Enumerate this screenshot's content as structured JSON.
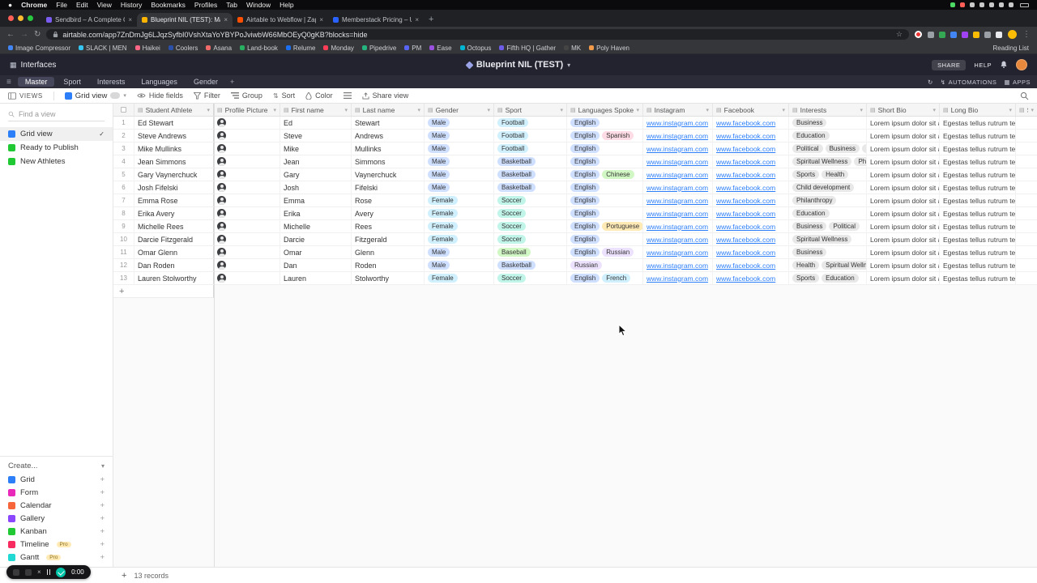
{
  "macos": {
    "menus": [
      "Chrome",
      "File",
      "Edit",
      "View",
      "History",
      "Bookmarks",
      "Profiles",
      "Tab",
      "Window",
      "Help"
    ],
    "status_colors": [
      "#4cd964",
      "#ff5f57",
      "#c9c9c9",
      "#c9c9c9",
      "#c9c9c9",
      "#c9c9c9",
      "#c9c9c9"
    ]
  },
  "browser": {
    "tabs": [
      {
        "title": "Sendbird – A Complete Chat P",
        "favicon": "#7a5cf0",
        "active": false
      },
      {
        "title": "Blueprint NIL (TEST): Master",
        "favicon": "#fcb400",
        "active": true
      },
      {
        "title": "Airtable to Webflow | Zapier",
        "favicon": "#ff4f00",
        "active": false
      },
      {
        "title": "Memberstack Pricing – Unlim",
        "favicon": "#2962ff",
        "active": false
      }
    ],
    "url": "airtable.com/app7ZnDmJg6LJqzSyfbI0VshXtaYoYBYPoJviwbW66MbOEyQ0gKB?blocks=hide",
    "extensions": [
      "#9aa0a6",
      "#34a853",
      "#4285f4",
      "#a142f4",
      "#fbbc04",
      "#9aa0a6",
      "#e8eaed"
    ],
    "reading_list": "Reading List",
    "bookmarks": [
      {
        "label": "Image Compressor",
        "color": "#4285f4"
      },
      {
        "label": "SLACK | MEN",
        "color": "#36c5f0"
      },
      {
        "label": "Haikei",
        "color": "#ff6584"
      },
      {
        "label": "Coolers",
        "color": "#2b50aa"
      },
      {
        "label": "Asana",
        "color": "#f06a6a"
      },
      {
        "label": "Land-book",
        "color": "#27ae60"
      },
      {
        "label": "Relume",
        "color": "#1d6ff2"
      },
      {
        "label": "Monday",
        "color": "#ff3d57"
      },
      {
        "label": "Pipedrive",
        "color": "#24b47e"
      },
      {
        "label": "PM",
        "color": "#5865f2"
      },
      {
        "label": "Ease",
        "color": "#9b51e0"
      },
      {
        "label": "Octopus",
        "color": "#00b5d1"
      },
      {
        "label": "Fifth HQ | Gather",
        "color": "#6c5ce7"
      },
      {
        "label": "MK",
        "color": "#444444"
      },
      {
        "label": "Poly Haven",
        "color": "#f2994a"
      }
    ]
  },
  "airtable": {
    "header": {
      "interfaces_label": "Interfaces",
      "title": "Blueprint NIL (TEST)",
      "share_label": "SHARE",
      "help_label": "HELP"
    },
    "tabbar": {
      "tabs": [
        "Master",
        "Sport",
        "Interests",
        "Languages",
        "Gender"
      ],
      "active": "Master",
      "automations_label": "AUTOMATIONS",
      "apps_label": "APPS"
    },
    "toolbar": {
      "views_label": "VIEWS",
      "view_name": "Grid view",
      "hide_fields": "Hide fields",
      "filter": "Filter",
      "group": "Group",
      "sort": "Sort",
      "color": "Color",
      "share_view": "Share view"
    },
    "sidebar": {
      "find_placeholder": "Find a view",
      "views": [
        {
          "name": "Grid view",
          "color": "#2d7ff9",
          "active": true
        },
        {
          "name": "Ready to Publish",
          "color": "#20c933",
          "active": false
        },
        {
          "name": "New Athletes",
          "color": "#20c933",
          "active": false
        }
      ],
      "create_label": "Create...",
      "create_items": [
        {
          "name": "Grid",
          "color": "#2d7ff9",
          "badge": ""
        },
        {
          "name": "Form",
          "color": "#e929ba",
          "badge": ""
        },
        {
          "name": "Calendar",
          "color": "#f7653b",
          "badge": ""
        },
        {
          "name": "Gallery",
          "color": "#8b46ff",
          "badge": ""
        },
        {
          "name": "Kanban",
          "color": "#20c933",
          "badge": ""
        },
        {
          "name": "Timeline",
          "color": "#f82b60",
          "badge": "Pro"
        },
        {
          "name": "Gantt",
          "color": "#20d9d2",
          "badge": "Pro"
        }
      ]
    },
    "grid": {
      "columns": [
        {
          "key": "name",
          "label": "Student Athlete"
        },
        {
          "key": "photo",
          "label": "Profile Picture"
        },
        {
          "key": "first",
          "label": "First name"
        },
        {
          "key": "last",
          "label": "Last name"
        },
        {
          "key": "gender",
          "label": "Gender"
        },
        {
          "key": "sport",
          "label": "Sport"
        },
        {
          "key": "languages",
          "label": "Languages Spoken"
        },
        {
          "key": "instagram",
          "label": "Instagram"
        },
        {
          "key": "facebook",
          "label": "Facebook"
        },
        {
          "key": "interests",
          "label": "Interests"
        },
        {
          "key": "short_bio",
          "label": "Short Bio"
        },
        {
          "key": "long_bio",
          "label": "Long Bio"
        },
        {
          "key": "stat",
          "label": "Stat"
        }
      ],
      "rows": [
        {
          "name": "Ed Stewart",
          "first": "Ed",
          "last": "Stewart",
          "gender": "Male",
          "sport": "Football",
          "languages": [
            "English"
          ],
          "instagram": "www.instagram.com",
          "facebook": "www.facebook.com",
          "interests": [
            "Business"
          ],
          "short_bio": "Lorem ipsum dolor sit amet, consectetur",
          "long_bio": "Egestas tellus rutrum tellus pellentesque"
        },
        {
          "name": "Steve Andrews",
          "first": "Steve",
          "last": "Andrews",
          "gender": "Male",
          "sport": "Football",
          "languages": [
            "English",
            "Spanish"
          ],
          "instagram": "www.instagram.com",
          "facebook": "www.facebook.com",
          "interests": [
            "Education"
          ],
          "short_bio": "Lorem ipsum dolor sit amet, consectetur",
          "long_bio": "Egestas tellus rutrum tellus pellentesque"
        },
        {
          "name": "Mike Mullinks",
          "first": "Mike",
          "last": "Mullinks",
          "gender": "Male",
          "sport": "Football",
          "languages": [
            "English"
          ],
          "instagram": "www.instagram.com",
          "facebook": "www.facebook.com",
          "interests": [
            "Political",
            "Business",
            "Community"
          ],
          "short_bio": "Lorem ipsum dolor sit amet, consectetur",
          "long_bio": "Egestas tellus rutrum tellus pellentesque"
        },
        {
          "name": "Jean Simmons",
          "first": "Jean",
          "last": "Simmons",
          "gender": "Male",
          "sport": "Basketball",
          "languages": [
            "English"
          ],
          "instagram": "www.instagram.com",
          "facebook": "www.facebook.com",
          "interests": [
            "Spiritual Wellness",
            "Philanthropy"
          ],
          "short_bio": "Lorem ipsum dolor sit amet, consectetur",
          "long_bio": "Egestas tellus rutrum tellus pellentesque"
        },
        {
          "name": "Gary Vaynerchuck",
          "first": "Gary",
          "last": "Vaynerchuck",
          "gender": "Male",
          "sport": "Basketball",
          "languages": [
            "English",
            "Chinese"
          ],
          "instagram": "www.instagram.com",
          "facebook": "www.facebook.com",
          "interests": [
            "Sports",
            "Health"
          ],
          "short_bio": "Lorem ipsum dolor sit amet, consectetur",
          "long_bio": "Egestas tellus rutrum tellus pellentesque"
        },
        {
          "name": "Josh Fifelski",
          "first": "Josh",
          "last": "Fifelski",
          "gender": "Male",
          "sport": "Basketball",
          "languages": [
            "English"
          ],
          "instagram": "www.instagram.com",
          "facebook": "www.facebook.com",
          "interests": [
            "Child development"
          ],
          "short_bio": "Lorem ipsum dolor sit amet, consectetur",
          "long_bio": "Egestas tellus rutrum tellus pellentesque"
        },
        {
          "name": "Emma Rose",
          "first": "Emma",
          "last": "Rose",
          "gender": "Female",
          "sport": "Soccer",
          "languages": [
            "English"
          ],
          "instagram": "www.instagram.com",
          "facebook": "www.facebook.com",
          "interests": [
            "Philanthropy"
          ],
          "short_bio": "Lorem ipsum dolor sit amet, consectetur",
          "long_bio": "Egestas tellus rutrum tellus pellentesque"
        },
        {
          "name": "Erika Avery",
          "first": "Erika",
          "last": "Avery",
          "gender": "Female",
          "sport": "Soccer",
          "languages": [
            "English"
          ],
          "instagram": "www.instagram.com",
          "facebook": "www.facebook.com",
          "interests": [
            "Education"
          ],
          "short_bio": "Lorem ipsum dolor sit amet, consectetur",
          "long_bio": "Egestas tellus rutrum tellus pellentesque"
        },
        {
          "name": "Michelle Rees",
          "first": "Michelle",
          "last": "Rees",
          "gender": "Female",
          "sport": "Soccer",
          "languages": [
            "English",
            "Portuguese"
          ],
          "instagram": "www.instagram.com",
          "facebook": "www.facebook.com",
          "interests": [
            "Business",
            "Political"
          ],
          "short_bio": "Lorem ipsum dolor sit amet, consectetur",
          "long_bio": "Egestas tellus rutrum tellus pellentesque"
        },
        {
          "name": "Darcie Fitzgerald",
          "first": "Darcie",
          "last": "Fitzgerald",
          "gender": "Female",
          "sport": "Soccer",
          "languages": [
            "English"
          ],
          "instagram": "www.instagram.com",
          "facebook": "www.facebook.com",
          "interests": [
            "Spiritual Wellness"
          ],
          "short_bio": "Lorem ipsum dolor sit amet, consectetur",
          "long_bio": "Egestas tellus rutrum tellus pellentesque"
        },
        {
          "name": "Omar Glenn",
          "first": "Omar",
          "last": "Glenn",
          "gender": "Male",
          "sport": "Baseball",
          "languages": [
            "English",
            "Russian"
          ],
          "instagram": "www.instagram.com",
          "facebook": "www.facebook.com",
          "interests": [
            "Business"
          ],
          "short_bio": "Lorem ipsum dolor sit amet, consectetur",
          "long_bio": "Egestas tellus rutrum tellus pellentesque"
        },
        {
          "name": "Dan Roden",
          "first": "Dan",
          "last": "Roden",
          "gender": "Male",
          "sport": "Basketball",
          "languages": [
            "Russian"
          ],
          "instagram": "www.instagram.com",
          "facebook": "www.facebook.com",
          "interests": [
            "Health",
            "Spiritual Wellness"
          ],
          "short_bio": "Lorem ipsum dolor sit amet, consectetur",
          "long_bio": "Egestas tellus rutrum tellus pellentesque"
        },
        {
          "name": "Lauren Stolworthy",
          "first": "Lauren",
          "last": "Stolworthy",
          "gender": "Female",
          "sport": "Soccer",
          "languages": [
            "English",
            "French"
          ],
          "instagram": "www.instagram.com",
          "facebook": "www.facebook.com",
          "interests": [
            "Sports",
            "Education"
          ],
          "short_bio": "Lorem ipsum dolor sit amet, consectetur",
          "long_bio": "Egestas tellus rutrum tellus pellentesque"
        }
      ],
      "footer_records": "13 records"
    }
  },
  "recorder": {
    "time": "0:00"
  },
  "icons": {
    "plus": "+",
    "close": "×",
    "check": "✓",
    "caret": "▾",
    "menu": "≡",
    "sort": "⇅",
    "dots": "⋮",
    "back": "←",
    "forward": "→",
    "reload": "↻",
    "grid9": "▦",
    "bolt": "↯",
    "apple": "●",
    "history": "↻"
  },
  "colors": {
    "pills": {
      "Male": "#cfdfff",
      "Female": "#d0f0fd",
      "Football": "#d0f0fd",
      "Basketball": "#cfdfff",
      "Soccer": "#c2f5e9",
      "Baseball": "#d1f7c4",
      "English": "#cfdfff",
      "Spanish": "#ffdce5",
      "Chinese": "#d1f7c4",
      "Portuguese": "#ffeab6",
      "Russian": "#ede2fe",
      "French": "#d0f0fd"
    },
    "interest_pill": "#e8e8e8",
    "accent_teal": "#00c4a7",
    "link_blue": "#2d7ff9"
  }
}
